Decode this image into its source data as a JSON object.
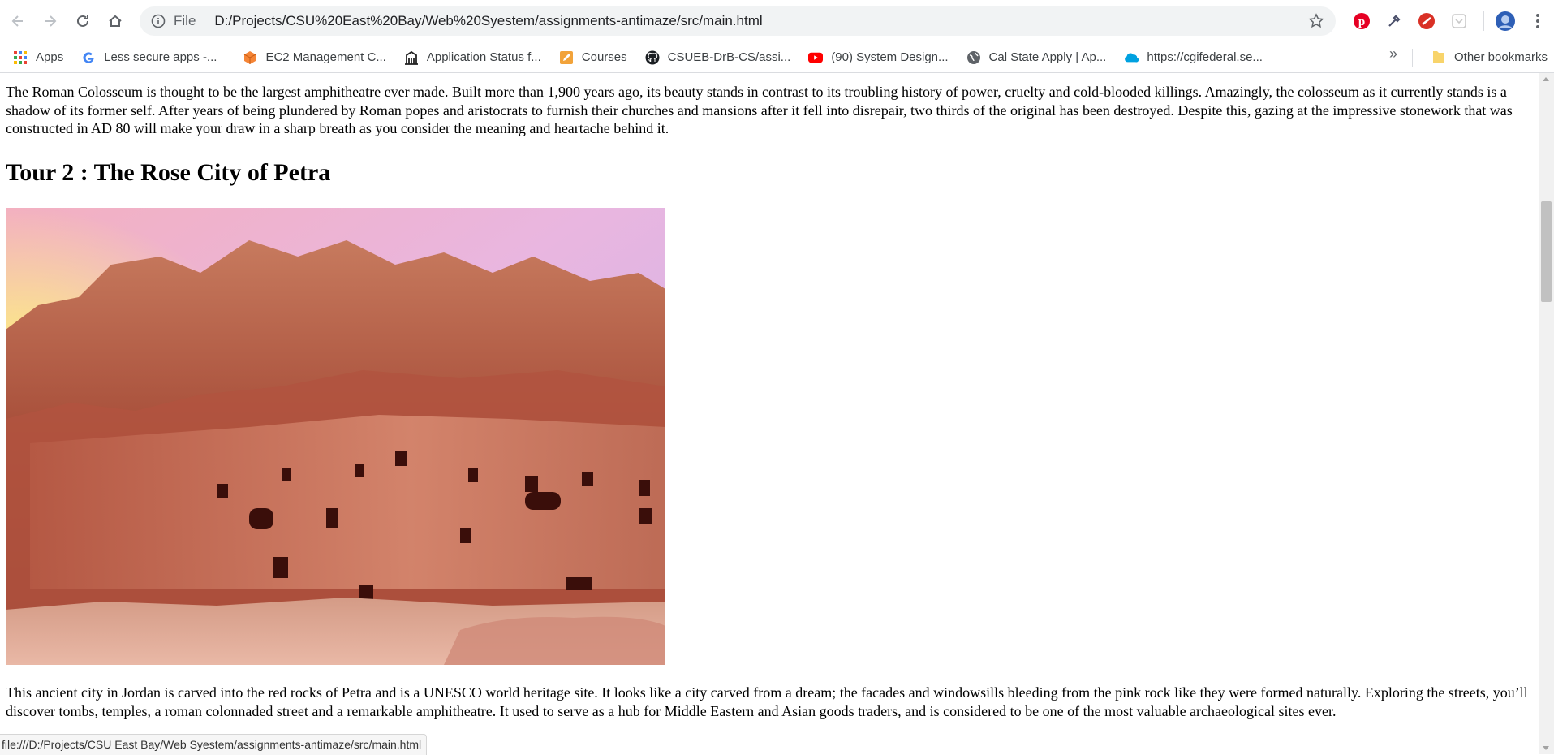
{
  "browser": {
    "address_scheme": "File",
    "address_url": "D:/Projects/CSU%20East%20Bay/Web%20Syestem/assignments-antimaze/src/main.html",
    "status_url": "file:///D:/Projects/CSU East Bay/Web Syestem/assignments-antimaze/src/main.html"
  },
  "bookmarks": {
    "items": [
      {
        "label": "Apps",
        "icon": "apps-grid-icon"
      },
      {
        "label": "Less secure apps -...",
        "icon": "google-icon"
      },
      {
        "label": "EC2 Management C...",
        "icon": "aws-cube-icon"
      },
      {
        "label": "Application Status f...",
        "icon": "building-icon"
      },
      {
        "label": "Courses",
        "icon": "pencil-icon"
      },
      {
        "label": "CSUEB-DrB-CS/assi...",
        "icon": "github-icon"
      },
      {
        "label": "(90) System Design...",
        "icon": "youtube-icon"
      },
      {
        "label": "Cal State Apply | Ap...",
        "icon": "globe-icon"
      },
      {
        "label": "https://cgifederal.se...",
        "icon": "salesforce-cloud-icon"
      }
    ],
    "overflow": "»",
    "other_label": "Other bookmarks"
  },
  "page": {
    "colosseum_text": "The Roman Colosseum is thought to be the largest amphitheatre ever made. Built more than 1,900 years ago, its beauty stands in contrast to its troubling history of power, cruelty and cold-blooded killings. Amazingly, the colosseum as it currently stands is a shadow of its former self. After years of being plundered by Roman popes and aristocrats to furnish their churches and mansions after it fell into disrepair, two thirds of the original has been destroyed. Despite this, gazing at the impressive stonework that was constructed in AD 80 will make your draw in a sharp breath as you consider the meaning and heartache behind it.",
    "tour2_heading": "Tour 2 : The Rose City of Petra",
    "petra_text": "This ancient city in Jordan is carved into the red rocks of Petra and is a UNESCO world heritage site. It looks like a city carved from a dream; the facades and windowsills bleeding from the pink rock like they were formed naturally. Exploring the streets, you’ll discover tombs, temples, a roman colonnaded street and a remarkable amphitheatre. It used to serve as a hub for Middle Eastern and Asian goods traders, and is considered to be one of the most valuable archaeological sites ever."
  },
  "colors": {
    "toolbar_bg": "#ffffff",
    "omnibox_bg": "#f1f3f4",
    "rock_dark": "#8a3a2a",
    "rock_light": "#d88a6a",
    "sky_pink": "#e6b0d8"
  }
}
